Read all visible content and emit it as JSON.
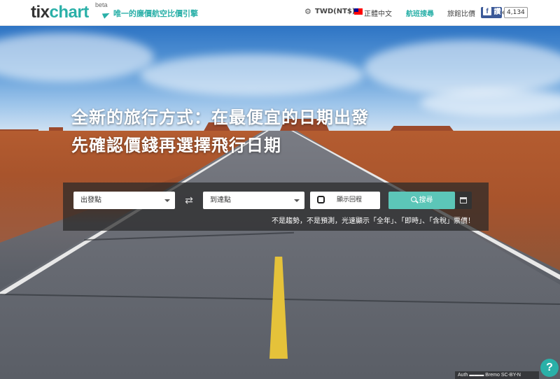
{
  "header": {
    "logo_tix": "tix",
    "logo_chart": "chart",
    "logo_beta": "beta",
    "tagline": "唯一的廉價航空比價引擎",
    "currency": "TWD(NT$) /",
    "language": "正體中文",
    "nav_flight_search": "航班搜尋",
    "nav_compare": "旅館比價",
    "fb_label": "讚",
    "fb_count": "4,134",
    "accent_color": "#2ab0a8"
  },
  "hero": {
    "headline_1": "全新的旅行方式：在最便宜的日期出發",
    "headline_2": "先確認價錢再選擇飛行日期"
  },
  "search": {
    "from_placeholder": "出發點",
    "to_placeholder": "到達點",
    "toggle_label": "顯示回程",
    "search_label": "搜尋",
    "note": "不是趨勢，不是預測，光速顯示「全年」、「即時」、「含稅」票價！"
  },
  "footer": {
    "help_label": "?",
    "strip_text": "Auth ▬▬▬ Bremo SC-BY-N"
  }
}
